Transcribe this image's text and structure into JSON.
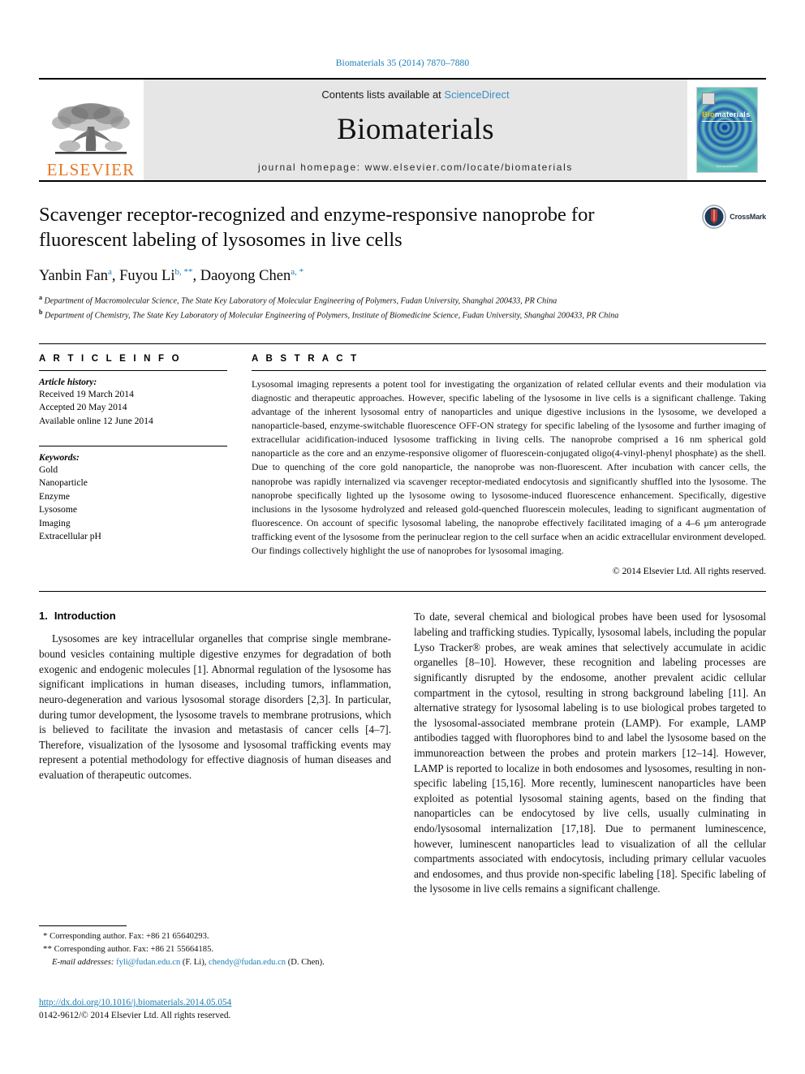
{
  "running_head": "Biomaterials 35 (2014) 7870–7880",
  "masthead": {
    "publisher_logo_text": "ELSEVIER",
    "contents_prefix": "Contents lists available at ",
    "contents_link": "ScienceDirect",
    "journal_name": "Biomaterials",
    "homepage_line": "journal homepage: www.elsevier.com/locate/biomaterials",
    "cover": {
      "title_bio": "Bio",
      "title_rest": "materials",
      "footer_text": "ScienceDirect"
    }
  },
  "article": {
    "title": "Scavenger receptor-recognized and enzyme-responsive nanoprobe for fluorescent labeling of lysosomes in live cells",
    "crossmark_label": "CrossMark",
    "authors": [
      {
        "name": "Yanbin Fan",
        "marks": "a"
      },
      {
        "name": "Fuyou Li",
        "marks": "b, **"
      },
      {
        "name": "Daoyong Chen",
        "marks": "a, *"
      }
    ],
    "authors_line": "Yanbin Fan a, Fuyou Li b, **, Daoyong Chen a, *",
    "affiliations": [
      {
        "mark": "a",
        "text": "Department of Macromolecular Science, The State Key Laboratory of Molecular Engineering of Polymers, Fudan University, Shanghai 200433, PR China"
      },
      {
        "mark": "b",
        "text": "Department of Chemistry, The State Key Laboratory of Molecular Engineering of Polymers, Institute of Biomedicine Science, Fudan University, Shanghai 200433, PR China"
      }
    ]
  },
  "article_info": {
    "heading": "A R T I C L E   I N F O",
    "history_label": "Article history:",
    "history": [
      "Received 19 March 2014",
      "Accepted 20 May 2014",
      "Available online 12 June 2014"
    ],
    "keywords_label": "Keywords:",
    "keywords": [
      "Gold",
      "Nanoparticle",
      "Enzyme",
      "Lysosome",
      "Imaging",
      "Extracellular pH"
    ]
  },
  "abstract": {
    "heading": "A B S T R A C T",
    "text": "Lysosomal imaging represents a potent tool for investigating the organization of related cellular events and their modulation via diagnostic and therapeutic approaches. However, specific labeling of the lysosome in live cells is a significant challenge. Taking advantage of the inherent lysosomal entry of nanoparticles and unique digestive inclusions in the lysosome, we developed a nanoparticle-based, enzyme-switchable fluorescence OFF-ON strategy for specific labeling of the lysosome and further imaging of extracellular acidification-induced lysosome trafficking in living cells. The nanoprobe comprised a 16 nm spherical gold nanoparticle as the core and an enzyme-responsive oligomer of fluorescein-conjugated oligo(4-vinyl-phenyl phosphate) as the shell. Due to quenching of the core gold nanoparticle, the nanoprobe was non-fluorescent. After incubation with cancer cells, the nanoprobe was rapidly internalized via scavenger receptor-mediated endocytosis and significantly shuffled into the lysosome. The nanoprobe specifically lighted up the lysosome owing to lysosome-induced fluorescence enhancement. Specifically, digestive inclusions in the lysosome hydrolyzed and released gold-quenched fluorescein molecules, leading to significant augmentation of fluorescence. On account of specific lysosomal labeling, the nanoprobe effectively facilitated imaging of a 4–6 μm anterograde trafficking event of the lysosome from the perinuclear region to the cell surface when an acidic extracellular environment developed. Our findings collectively highlight the use of nanoprobes for lysosomal imaging.",
    "copyright": "© 2014 Elsevier Ltd. All rights reserved."
  },
  "body": {
    "section_number": "1.",
    "section_title": "Introduction",
    "paragraph_1": "Lysosomes are key intracellular organelles that comprise single membrane-bound vesicles containing multiple digestive enzymes for degradation of both exogenic and endogenic molecules [1]. Abnormal regulation of the lysosome has significant implications in human diseases, including tumors, inflammation, neuro-degeneration and various lysosomal storage disorders [2,3]. In particular, during tumor development, the lysosome travels to membrane protrusions, which is believed to facilitate the invasion and metastasis of cancer cells [4–7]. Therefore, visualization of the lysosome and lysosomal trafficking events may represent a potential methodology for effective diagnosis of human diseases and evaluation of therapeutic outcomes.",
    "paragraph_2": "To date, several chemical and biological probes have been used for lysosomal labeling and trafficking studies. Typically, lysosomal labels, including the popular Lyso Tracker® probes, are weak amines that selectively accumulate in acidic organelles [8–10]. However, these recognition and labeling processes are significantly disrupted by the endosome, another prevalent acidic cellular compartment in the cytosol, resulting in strong background labeling [11]. An alternative strategy for lysosomal labeling is to use biological probes targeted to the lysosomal-associated membrane protein (LAMP). For example, LAMP antibodies tagged with fluorophores bind to and label the lysosome based on the immunoreaction between the probes and protein markers [12–14]. However, LAMP is reported to localize in both endosomes and lysosomes, resulting in non-specific labeling [15,16]. More recently, luminescent nanoparticles have been exploited as potential lysosomal staining agents, based on the finding that nanoparticles can be endocytosed by live cells, usually culminating in endo/lysosomal internalization [17,18]. Due to permanent luminescence, however, luminescent nanoparticles lead to visualization of all the cellular compartments associated with endocytosis, including primary cellular vacuoles and endosomes, and thus provide non-specific labeling [18]. Specific labeling of the lysosome in live cells remains a significant challenge."
  },
  "footnotes": {
    "corresponding_1": "Corresponding author. Fax: +86 21 65640293.",
    "corresponding_2": "Corresponding author. Fax: +86 21 55664185.",
    "email_label": "E-mail addresses:",
    "email_1": "fyli@fudan.edu.cn",
    "email_1_owner": "(F. Li),",
    "email_2": "chendy@fudan.edu.cn",
    "email_2_owner": "(D. Chen)."
  },
  "footer": {
    "doi": "http://dx.doi.org/10.1016/j.biomaterials.2014.05.054",
    "issn": "0142-9612/© 2014 Elsevier Ltd. All rights reserved."
  },
  "colors": {
    "link_blue": "#1a7db6",
    "sciencedirect_blue": "#3b8ec4",
    "elsevier_orange": "#E87722",
    "masthead_grey": "#e6e6e6"
  }
}
